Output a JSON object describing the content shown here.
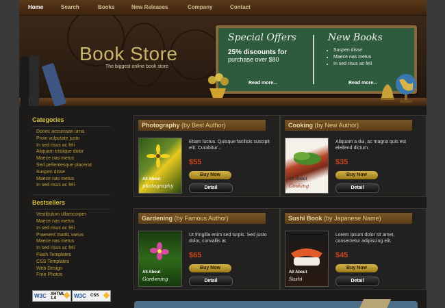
{
  "nav": {
    "items": [
      "Home",
      "Search",
      "Books",
      "New Releases",
      "Company",
      "Contact"
    ],
    "active": "Home"
  },
  "header": {
    "logo": "Book Store",
    "tagline": "The biggest online book store",
    "special_offers": {
      "title": "Special Offers",
      "line1": "25% discounts for",
      "line2": "purchase over $80",
      "more": "Read more..."
    },
    "new_books": {
      "title": "New Books",
      "items": [
        "Suspen disse",
        "Maece nas metus",
        "In sed risus ac feli"
      ],
      "more": "Read more..."
    }
  },
  "sidebar": {
    "categories_title": "Categories",
    "categories": [
      "Donec accumsan urna",
      "Proin vulputate justo",
      "In sed risus ac feli",
      "Aliquam tristique dolor",
      "Maece nas metus",
      "Sed pellentesque placerat",
      "Suspen disse",
      "Maece nas metus",
      "In sed risus ac feli"
    ],
    "bestsellers_title": "Bestsellers",
    "bestsellers": [
      "Vestibulum ullamcorper",
      "Maece nas metus",
      "In sed risus ac feli",
      "Praesent mattis varius",
      "Maece nas metus",
      "In sed risus ac feli",
      "Flash Templates",
      "CSS Templates",
      "Web Design",
      "Free Photos"
    ],
    "badges": [
      {
        "org": "W3C",
        "label1": "XHTML",
        "label2": "1.0"
      },
      {
        "org": "W3C",
        "label1": "CSS",
        "label2": ""
      }
    ]
  },
  "products": [
    {
      "title": "Photography",
      "subtitle": "(by Best Author)",
      "description": "Etiam luctus. Quisque facilisis suscipit elit. Curabitur...",
      "price": "$55",
      "cover_all": "All About",
      "cover_sub": "photography",
      "buy": "Buy Now",
      "detail": "Detail"
    },
    {
      "title": "Cooking",
      "subtitle": "(by New Author)",
      "description": "Aliquam a dui, ac magna quis est eleifend dictum.",
      "price": "$35",
      "cover_all": "All About",
      "cover_sub": "Cooking",
      "buy": "Buy Now",
      "detail": "Detail"
    },
    {
      "title": "Gardening",
      "subtitle": "(by Famous Author)",
      "description": "Ut fringilla enim sed turpis. Sed justo dolor, convallis at.",
      "price": "$65",
      "cover_all": "All About",
      "cover_sub": "Gardening",
      "buy": "Buy Now",
      "detail": "Detail"
    },
    {
      "title": "Sushi Book",
      "subtitle": "(by Japanese Name)",
      "description": "Lorem ipsum dolor sit amet, consectetur adipiscing elit.",
      "price": "$45",
      "cover_all": "All About",
      "cover_sub": "Sushi",
      "buy": "Buy Now",
      "detail": "Detail"
    }
  ],
  "colors": {
    "accent_gold": "#d8c23a",
    "price_red": "#c9451d",
    "board_green": "#2e5a3d"
  }
}
